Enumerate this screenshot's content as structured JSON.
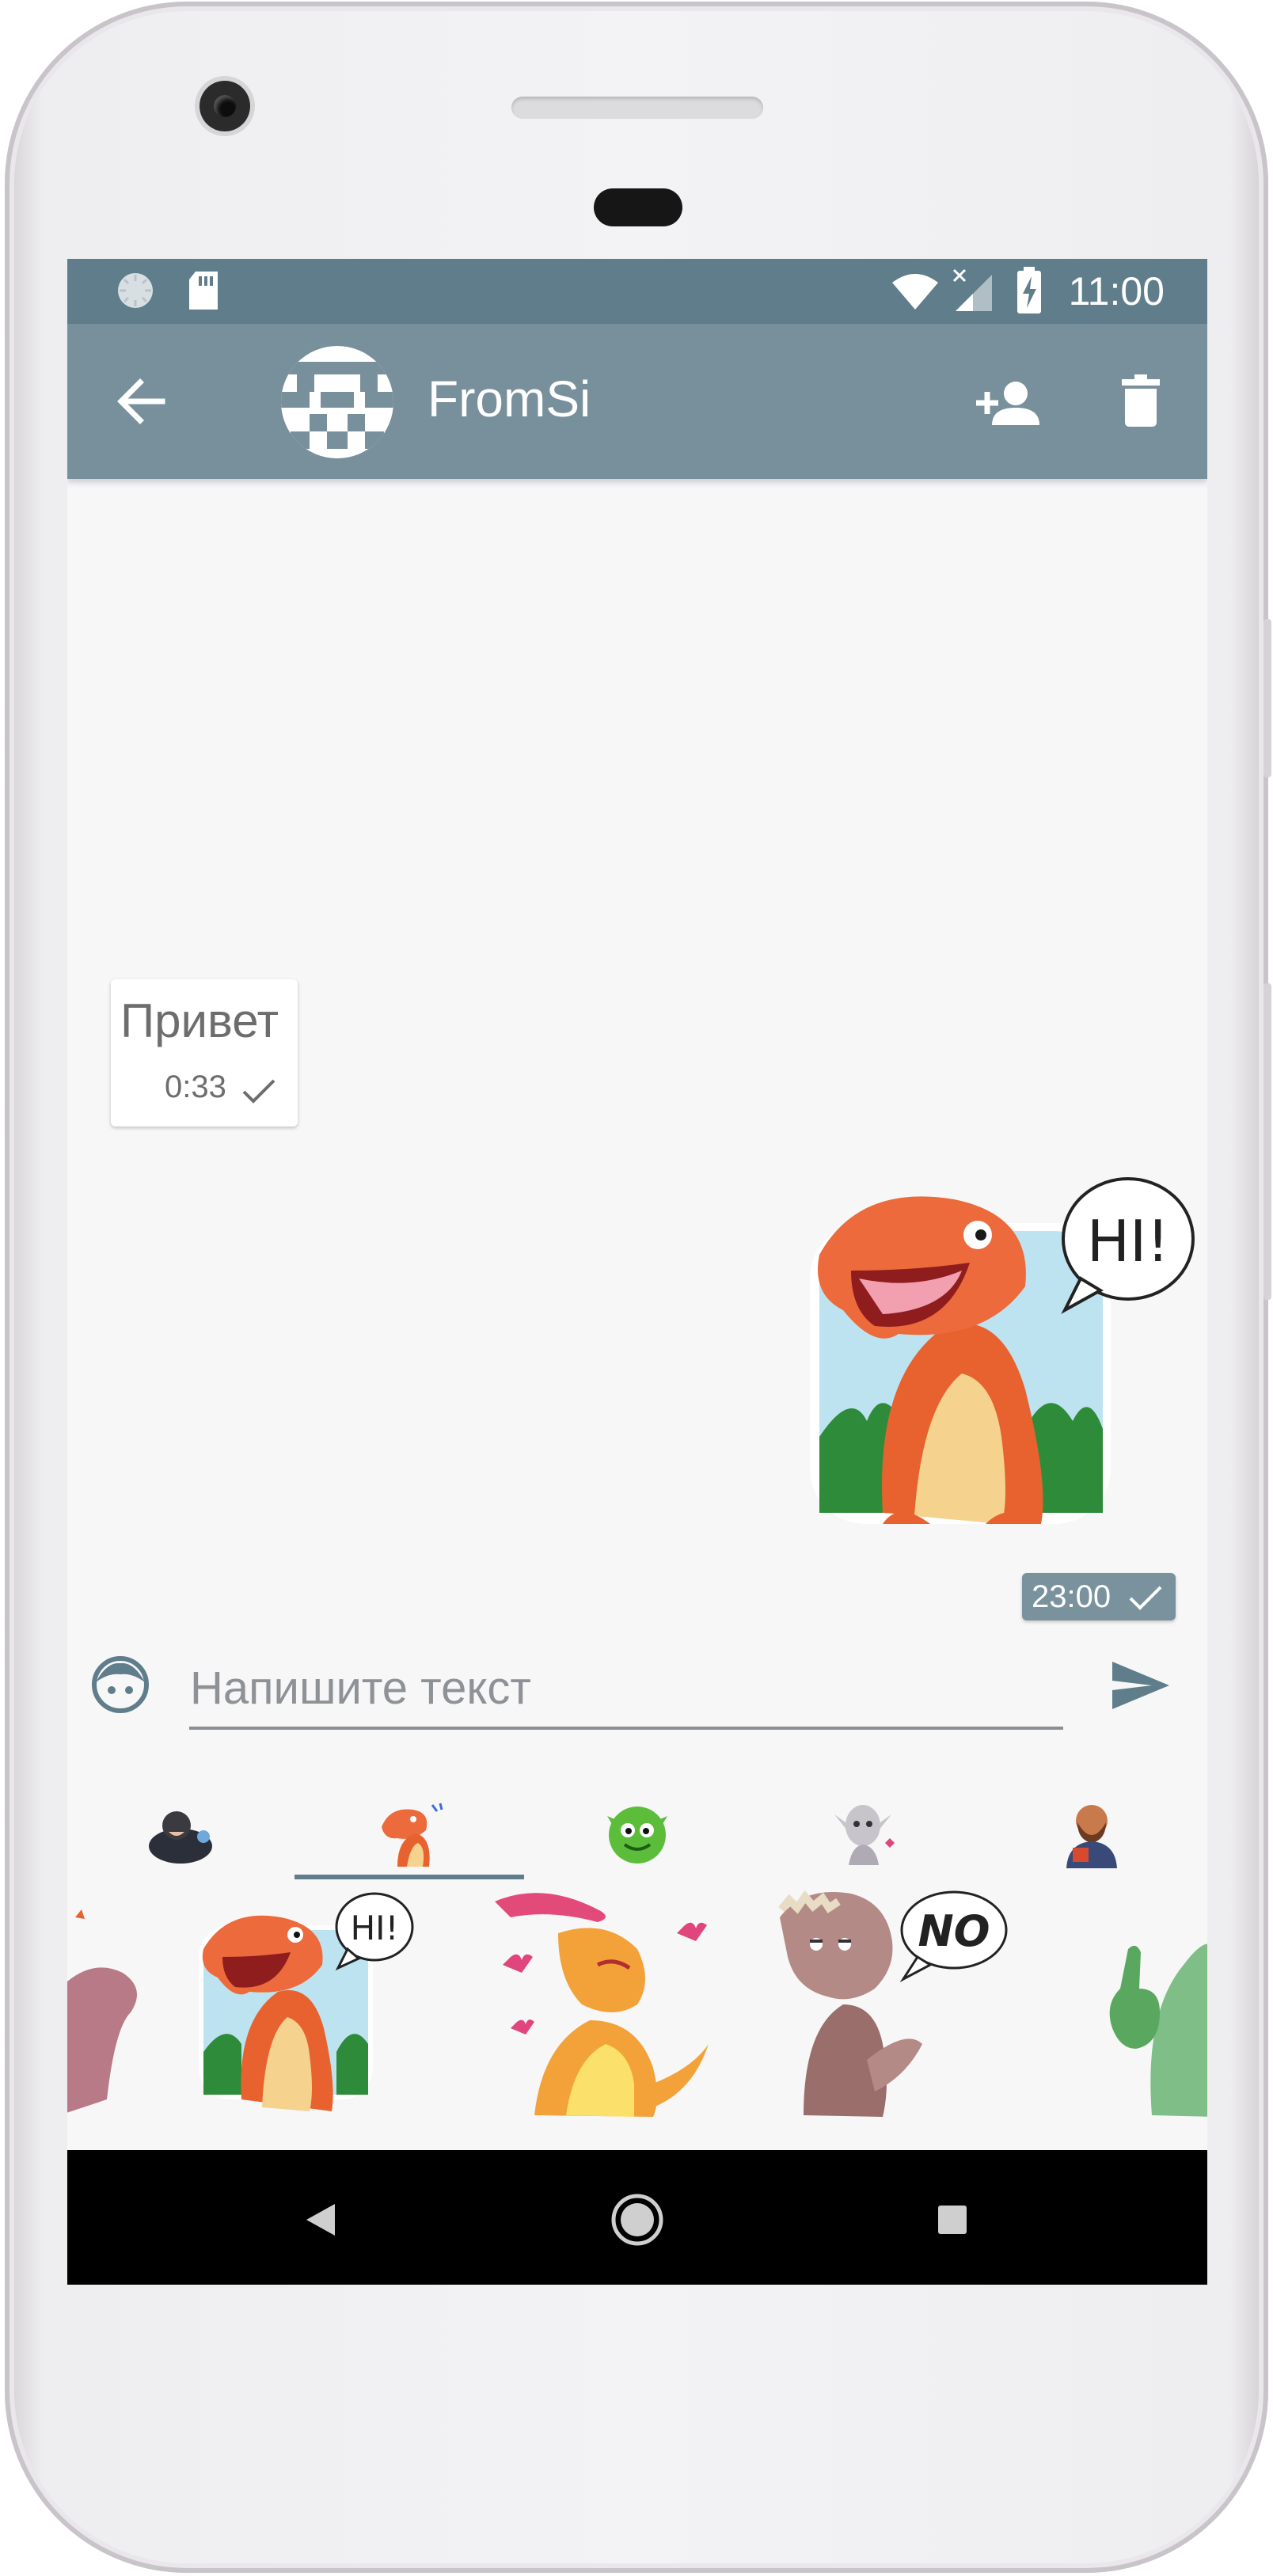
{
  "status_bar": {
    "time": "11:00"
  },
  "app_bar": {
    "title": "FromSi"
  },
  "messages": [
    {
      "direction": "incoming",
      "type": "text",
      "text": "Привет",
      "time": "0:33"
    },
    {
      "direction": "outgoing",
      "type": "sticker",
      "sticker_text": "HI!",
      "time": "23:00"
    }
  ],
  "composer": {
    "placeholder": "Напишите текст"
  },
  "sticker_tabs": [
    {
      "icon": "sticker-pack-dark-character"
    },
    {
      "icon": "sticker-pack-dino",
      "selected": true
    },
    {
      "icon": "sticker-pack-green-monster"
    },
    {
      "icon": "sticker-pack-elf"
    },
    {
      "icon": "sticker-pack-bearded-man"
    }
  ],
  "sticker_grid": [
    {
      "icon": "dino-partial-sticker"
    },
    {
      "icon": "dino-hi-sticker",
      "text": "HI!"
    },
    {
      "icon": "dino-love-sticker"
    },
    {
      "icon": "dino-no-sticker",
      "text": "NO"
    },
    {
      "icon": "dino-thumbs-up-sticker"
    }
  ],
  "colors": {
    "status_bar": "#607d8b",
    "app_bar": "#78909c",
    "chat_background": "#f7f7f8",
    "tab_indicator": "#607d8b"
  }
}
